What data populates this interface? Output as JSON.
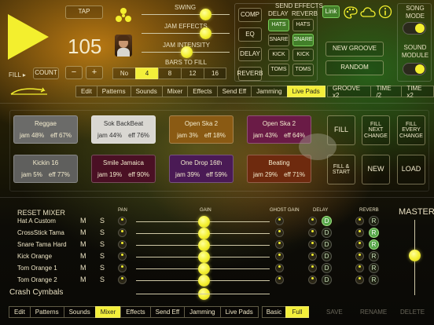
{
  "header": {
    "tap": "TAP",
    "tempo": "105",
    "fill_label": "FILL ▸",
    "count_label": "COUNT",
    "minus": "−",
    "plus": "+"
  },
  "sliders": {
    "swing": "SWING",
    "jam_effects": "JAM EFFECTS",
    "jam_intensity": "JAM INTENSITY",
    "bars_to_fill": "BARS TO FILL",
    "bars_options": [
      "No",
      "4",
      "8",
      "12",
      "16"
    ],
    "bars_selected": "4"
  },
  "effects": {
    "labels": [
      "COMP",
      "EQ",
      "DELAY",
      "REVERB"
    ],
    "send_effects": "SEND EFFECTS",
    "delay": "DELAY",
    "reverb": "REVERB",
    "rows": [
      [
        "HATS",
        "HATS"
      ],
      [
        "SNARE",
        "SNARE"
      ],
      [
        "KICK",
        "KICK"
      ],
      [
        "TOMS",
        "TOMS"
      ]
    ]
  },
  "right": {
    "link": "Link",
    "new_groove": "NEW GROOVE",
    "random": "RANDOM",
    "song_mode": "SONG MODE",
    "sound_module": "SOUND MODULE"
  },
  "tabs_top": [
    "Edit",
    "Patterns",
    "Sounds",
    "Mixer",
    "Effects",
    "Send Eff",
    "Jamming",
    "Live Pads"
  ],
  "tabs_top_active": "Live Pads",
  "groove_buttons": [
    "GROOVE x2",
    "TIME /2",
    "TIME x2"
  ],
  "pads": [
    {
      "name": "Reggae",
      "jam": "jam 48%",
      "eff": "eff 67%",
      "color": "#6b6b69"
    },
    {
      "name": "Sok BackBeat",
      "jam": "jam 44%",
      "eff": "eff 76%",
      "color": "#d9d7d2"
    },
    {
      "name": "Open Ska 2",
      "jam": "jam 3%",
      "eff": "eff 18%",
      "color": "#8a5a13"
    },
    {
      "name": "Open Ska 2",
      "jam": "jam 43%",
      "eff": "eff 64%",
      "color": "#6a1b46"
    },
    {
      "name": "Kickin 16",
      "jam": "jam 5%",
      "eff": "eff 77%",
      "color": "#5f5f5d"
    },
    {
      "name": "Smile Jamaica",
      "jam": "jam 19%",
      "eff": "eff 90%",
      "color": "#4a1024"
    },
    {
      "name": "One Drop 16th",
      "jam": "jam 39%",
      "eff": "eff 59%",
      "color": "#4a1a55"
    },
    {
      "name": "Beating",
      "jam": "jam 29%",
      "eff": "eff 71%",
      "color": "#6e2a0e"
    }
  ],
  "pad_actions": [
    "FILL",
    "FILL NEXT CHANGE",
    "FILL EVERY CHANGE",
    "FILL & START",
    "NEW",
    "LOAD"
  ],
  "mixer": {
    "reset": "RESET MIXER",
    "pan": "PAN",
    "gain": "GAIN",
    "ghost_gain": "GHOST GAIN",
    "delay": "DELAY",
    "reverb": "REVERB",
    "master": "MASTER",
    "m": "M",
    "s": "S",
    "d": "D",
    "r": "R",
    "tracks": [
      {
        "name": "Hat A Custom",
        "d_on": true,
        "r_on": false
      },
      {
        "name": "CrossStick Tama",
        "d_on": false,
        "r_on": true
      },
      {
        "name": "Snare Tama Hard",
        "d_on": false,
        "r_on": true
      },
      {
        "name": "Kick Orange",
        "d_on": false,
        "r_on": false
      },
      {
        "name": "Tom Orange 1",
        "d_on": false,
        "r_on": false
      },
      {
        "name": "Tom Orange 2",
        "d_on": false,
        "r_on": false
      }
    ],
    "last_track": "Crash Cymbals"
  },
  "tabs_bottom": [
    "Edit",
    "Patterns",
    "Sounds",
    "Mixer",
    "Effects",
    "Send Eff",
    "Jamming",
    "Live Pads"
  ],
  "tabs_bottom_active": "Mixer",
  "view_modes": [
    "Basic",
    "Full"
  ],
  "view_active": "Full",
  "bottom_actions": [
    "SAVE",
    "RENAME",
    "DELETE"
  ],
  "colors": {
    "accent": "#f3ef3a",
    "green": "#58a54b"
  }
}
